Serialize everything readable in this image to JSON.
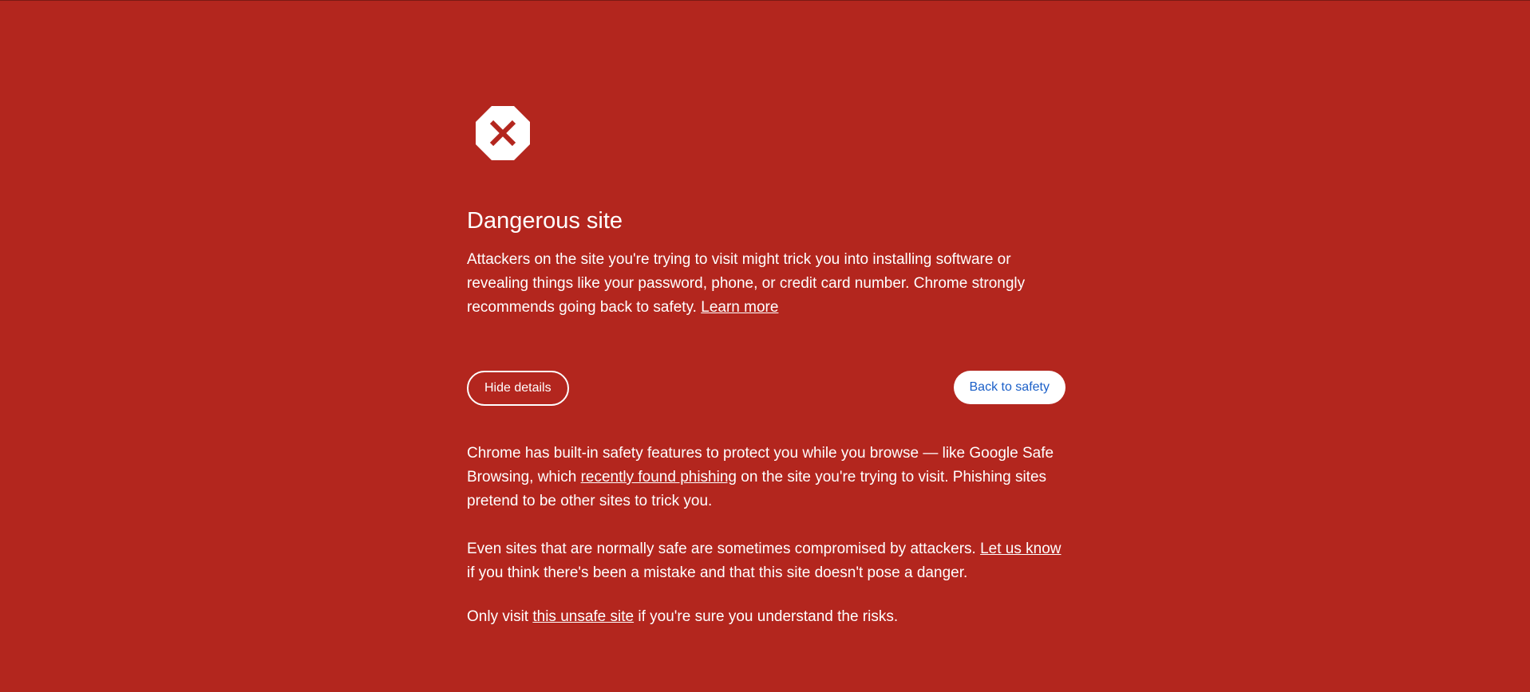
{
  "icon": {
    "name": "danger-stop-icon",
    "fill": "#ffffff",
    "mark_color": "#b3261e"
  },
  "colors": {
    "background": "#b3261e",
    "text": "#ffffff",
    "primary_button_text": "#1a5fc8"
  },
  "title": "Dangerous site",
  "intro": {
    "text": "Attackers on the site you're trying to visit might trick you into installing software or revealing things like your password, phone, or credit card number. Chrome strongly recommends going back to safety. ",
    "link": "Learn more"
  },
  "buttons": {
    "hide_details": "Hide details",
    "back_to_safety": "Back to safety"
  },
  "details": {
    "p1_before": "Chrome has built-in safety features to protect you while you browse — like Google Safe Browsing, which ",
    "p1_link": "recently found phishing",
    "p1_after": " on the site you're trying to visit. Phishing sites pretend to be other sites to trick you.",
    "p2_before": "Even sites that are normally safe are sometimes compromised by attackers. ",
    "p2_link": "Let us know",
    "p2_after": " if you think there's been a mistake and that this site doesn't pose a danger.",
    "p3_before": "Only visit ",
    "p3_link": "this unsafe site",
    "p3_after": " if you're sure you understand the risks."
  }
}
